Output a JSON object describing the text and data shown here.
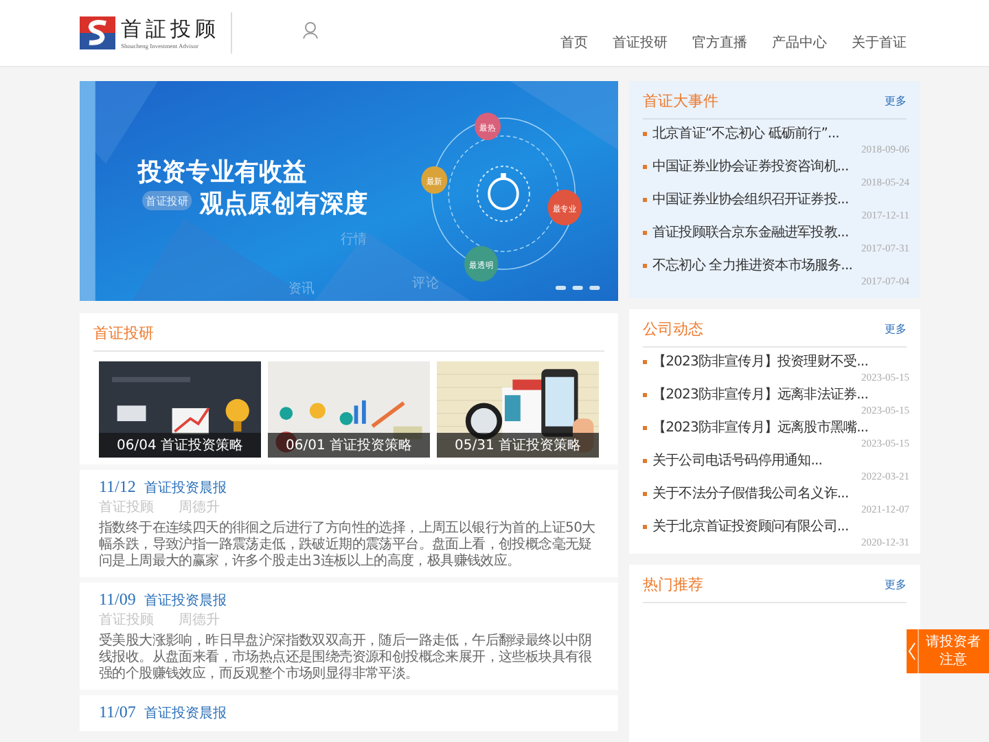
{
  "header": {
    "logo_text": "首証投顾",
    "logo_subtext": "Shoucheng Investment Advisor",
    "nav": [
      {
        "label": "首页"
      },
      {
        "label": "首证投研"
      },
      {
        "label": "官方直播"
      },
      {
        "label": "产品中心"
      },
      {
        "label": "关于首证"
      }
    ]
  },
  "banner": {
    "headline": "投资专业有收益",
    "tag": "首证投研",
    "subline": "观点原创有深度",
    "faint_words": [
      "行情",
      "资讯",
      "评论"
    ],
    "bubbles": [
      {
        "label": "最热",
        "color": "#d9607a"
      },
      {
        "label": "最新",
        "color": "#d9a33a"
      },
      {
        "label": "最专业",
        "color": "#e0553f"
      },
      {
        "label": "最透明",
        "color": "#3f9a86"
      }
    ]
  },
  "research": {
    "title": "首证投研",
    "thumbnails": [
      {
        "kind": "picture",
        "caption": "06/04 首证投资策略"
      },
      {
        "kind": "picture",
        "caption": "06/01 首证投资策略"
      },
      {
        "kind": "picture",
        "caption": "05/31 首证投资策略"
      }
    ],
    "articles": [
      {
        "date": "11/12",
        "title": "首证投资晨报",
        "source": "首证投顾",
        "author": "周德升",
        "body": "指数终于在连续四天的徘徊之后进行了方向性的选择，上周五以银行为首的上证50大幅杀跌，导致沪指一路震荡走低，跌破近期的震荡平台。盘面上看，创投概念毫无疑问是上周最大的赢家，许多个股走出3连板以上的高度，极具赚钱效应。"
      },
      {
        "date": "11/09",
        "title": "首证投资晨报",
        "source": "首证投顾",
        "author": "周德升",
        "body": "受美股大涨影响，昨日早盘沪深指数双双高开，随后一路走低，午后翻绿最终以中阴线报收。从盘面来看，市场热点还是围绕壳资源和创投概念来展开，这些板块具有很强的个股赚钱效应，而反观整个市场则显得非常平淡。"
      },
      {
        "date": "11/07",
        "title": "首证投资晨报"
      }
    ]
  },
  "events": {
    "title": "首证大事件",
    "more": "更多",
    "items": [
      {
        "title": "北京首证“不忘初心 砥砺前行”...",
        "date": "2018-09-06"
      },
      {
        "title": "中国证券业协会证券投资咨询机...",
        "date": "2018-05-24"
      },
      {
        "title": "中国证券业协会组织召开证券投...",
        "date": "2017-12-11"
      },
      {
        "title": "首证投顾联合京东金融进军投教...",
        "date": "2017-07-31"
      },
      {
        "title": "不忘初心 全力推进资本市场服务...",
        "date": "2017-07-04"
      }
    ]
  },
  "news": {
    "title": "公司动态",
    "more": "更多",
    "items": [
      {
        "title": "【2023防非宣传月】投资理财不受...",
        "date": "2023-05-15"
      },
      {
        "title": "【2023防非宣传月】远离非法证券...",
        "date": "2023-05-15"
      },
      {
        "title": "【2023防非宣传月】远离股市黑嘴...",
        "date": "2023-05-15"
      },
      {
        "title": "关于公司电话号码停用通知...",
        "date": "2022-03-21"
      },
      {
        "title": "关于不法分子假借我公司名义诈...",
        "date": "2021-12-07"
      },
      {
        "title": "关于北京首证投资顾问有限公司...",
        "date": "2020-12-31"
      }
    ]
  },
  "hot": {
    "title": "热门推荐",
    "more": "更多"
  },
  "notice_tab": {
    "label": "请投资者注意"
  }
}
